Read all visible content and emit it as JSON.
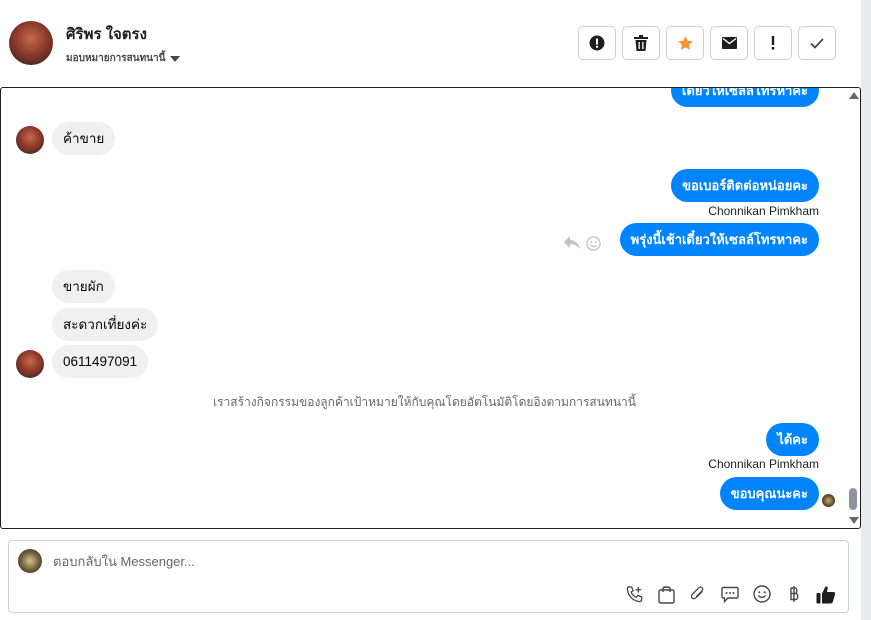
{
  "header": {
    "contact_name": "ศิริพร ใจตรง",
    "assign_label": "มอบหมายการสนทนานี้",
    "actions": [
      {
        "name": "alert-circle",
        "label": "Mark as spam"
      },
      {
        "name": "trash",
        "label": "Delete"
      },
      {
        "name": "star",
        "label": "Star",
        "color": "#f7923a"
      },
      {
        "name": "envelope",
        "label": "Mark unread"
      },
      {
        "name": "exclamation",
        "label": "Follow up"
      },
      {
        "name": "check",
        "label": "Mark done"
      }
    ]
  },
  "messages": [
    {
      "dir": "out",
      "text": "เดี๋ยวให้เซลล์โทรหาคะ"
    },
    {
      "dir": "in",
      "text": "ค้าขาย"
    },
    {
      "dir": "out",
      "text": "ขอเบอร์ติดต่อหน่อยคะ"
    },
    {
      "dir": "out",
      "text": "พรุ่งนี้เช้าเดี๋ยวให้เซลล์โทรหาคะ"
    },
    {
      "dir": "in",
      "text": "ขายผัก"
    },
    {
      "dir": "in",
      "text": "สะดวกเที่ยงค่ะ"
    },
    {
      "dir": "in",
      "text": "0611497091"
    },
    {
      "dir": "out",
      "text": "ได้คะ"
    },
    {
      "dir": "out",
      "text": "ขอบคุณนะคะ"
    }
  ],
  "senders": [
    "Chonnikan Pimkham",
    "Chonnikan Pimkham"
  ],
  "system_note": "เราสร้างกิจกรรมของลูกค้าเป้าหมายให้กับคุณโดยอัตโนมัติโดยอิงตามการสนทนานี้",
  "composer": {
    "placeholder": "ตอบกลับใน Messenger...",
    "tools": [
      "phone-add-icon",
      "bag-icon",
      "paperclip-icon",
      "speech-bubble-icon",
      "smiley-icon",
      "baht-icon",
      "thumbs-up-icon"
    ]
  },
  "colors": {
    "accent": "#0084ff",
    "star": "#f7923a",
    "incoming": "#f0f0f0"
  }
}
